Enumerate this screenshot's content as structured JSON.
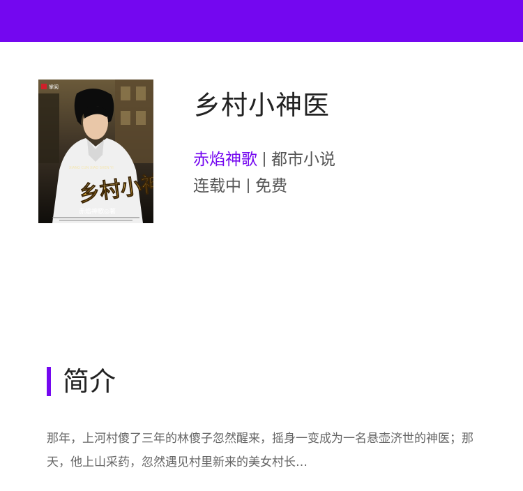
{
  "header": {
    "color": "#7407f0"
  },
  "book": {
    "title": "乡村小神医",
    "author": "赤焰神歌",
    "category": "都市小说",
    "status": "连载中",
    "price": "免费",
    "cover": {
      "publisher": "掌阅",
      "title_art": "乡村小神医",
      "pinyin": "XIANG CUN XIAO SHEN YI",
      "author_line": "赤焰神歌◎著"
    }
  },
  "synopsis": {
    "heading": "简介",
    "text": "那年，上河村傻了三年的林傻子忽然醒来，摇身一变成为一名悬壶济世的神医；那天，他上山采药，忽然遇见村里新来的美女村长…"
  },
  "colors": {
    "accent": "#7407f0",
    "text": "#222222",
    "muted": "#666666"
  }
}
